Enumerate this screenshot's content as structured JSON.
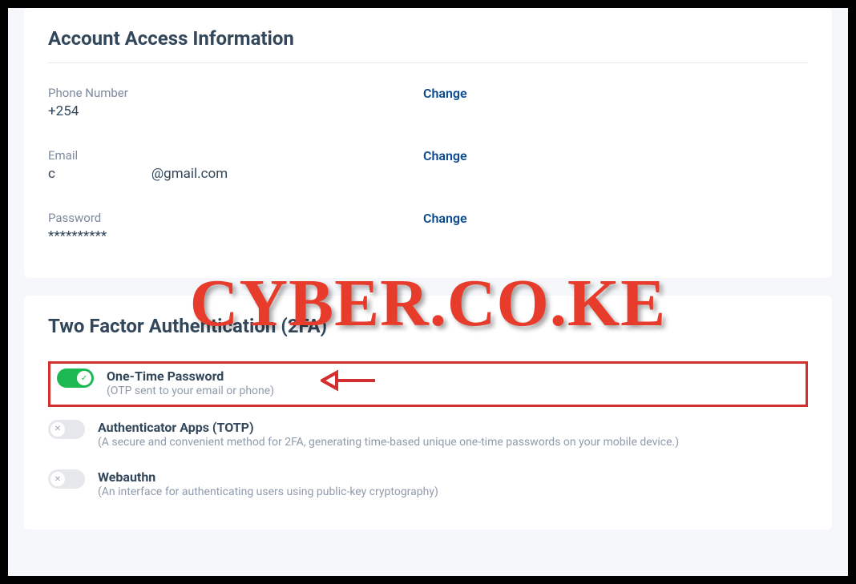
{
  "account": {
    "title": "Account Access Information",
    "phone": {
      "label": "Phone Number",
      "value": "+254",
      "change": "Change"
    },
    "email": {
      "label": "Email",
      "value_prefix": "c",
      "value_suffix": "@gmail.com",
      "change": "Change"
    },
    "password": {
      "label": "Password",
      "value": "**********",
      "change": "Change"
    }
  },
  "twofa": {
    "title": "Two Factor Authentication (2FA)",
    "otp": {
      "title": "One-Time Password",
      "desc": "(OTP sent to your email or phone)",
      "enabled": true
    },
    "totp": {
      "title": "Authenticator Apps (TOTP)",
      "desc": "(A secure and convenient method for 2FA, generating time-based unique one-time passwords on your mobile device.)",
      "enabled": false
    },
    "webauthn": {
      "title": "Webauthn",
      "desc": "(An interface for authenticating users using public-key cryptography)",
      "enabled": false
    }
  },
  "watermark": "CYBER.CO.KE",
  "icons": {
    "check": "✓",
    "x": "✕"
  }
}
